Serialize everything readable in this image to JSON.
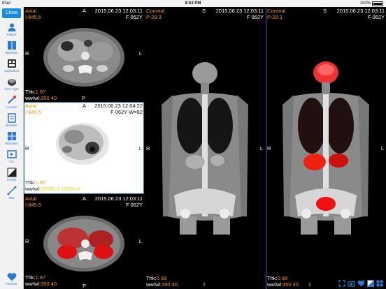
{
  "status": {
    "device": "iPad",
    "time": "8:53 PM",
    "battery": "100%"
  },
  "sidebar": {
    "close_label": "Close",
    "items": [
      {
        "label": "Patient",
        "icon": "person-icon"
      },
      {
        "label": "Windows",
        "icon": "windows-icon"
      },
      {
        "label": "Application",
        "icon": "application-icon"
      },
      {
        "label": "View Type",
        "icon": "view-type-icon"
      },
      {
        "label": "Locator",
        "icon": "locator-icon"
      },
      {
        "label": "Browser",
        "icon": "browser-icon"
      },
      {
        "label": "Windows",
        "icon": "windows-icon"
      },
      {
        "label": "Cin",
        "icon": "cine-icon"
      },
      {
        "label": "Preset",
        "icon": "preset-icon"
      },
      {
        "label": "ROI",
        "icon": "roi-icon"
      },
      {
        "label": "Favorite",
        "icon": "heart-icon"
      }
    ]
  },
  "viewports": {
    "axial_ct": {
      "series": "Axial",
      "level": "I:845.5",
      "orient_top": "A",
      "datetime": "2015.06.23 12:03:11",
      "patient": "F 062Y",
      "left": "R",
      "right": "L",
      "bottom": "P"
    },
    "axial_pet": {
      "series": "Axial",
      "level": "I:845.5",
      "orient_top": "A",
      "datetime": "2015.06.23 12:04:22",
      "patient": "F 062Y W=82",
      "left": "R",
      "right": "L",
      "thk_label": "Thk:",
      "thk_value": "1.87",
      "wwwl_label": "ww/wl:",
      "wwwl_value": "20000.0 10000.0"
    },
    "axial_fusion": {
      "series": "Axial",
      "level": "I:845.5",
      "orient_top": "A",
      "datetime": "2015.06.23 12:03:11",
      "patient": "F 062Y",
      "left": "R",
      "right": "L",
      "bottom": "P",
      "thk_label": "Thk:",
      "thk_value": "1.87",
      "wwwl_label": "ww/wl:",
      "wwwl_value": "350 40"
    },
    "coronal_ct": {
      "series": "Coronal",
      "level": "P:29.3",
      "orient_top": "S",
      "datetime": "2015.06.23 12:03:11",
      "patient": "F 062Y",
      "left": "R",
      "right": "L",
      "bottom": "I",
      "thk_label": "Thk:",
      "thk_value": "0.98",
      "wwwl_label": "ww/wl:",
      "wwwl_value": "350 40"
    },
    "coronal_fusion": {
      "series": "Coronal",
      "level": "P:29.3",
      "orient_top": "S",
      "datetime": "2015.06.23 12:03:11",
      "patient": "F 062Y",
      "left": "R",
      "right": "L",
      "bottom": "I",
      "thk_label": "Thk:",
      "thk_value": "0.98",
      "wwwl_label": "ww/wl:",
      "wwwl_value": "350 40"
    },
    "axial_ct_footer": {
      "thk_label": "Thk:",
      "thk_value": "1.87",
      "wwwl_label": "ww/wl:",
      "wwwl_value": "350 40"
    }
  },
  "colors": {
    "accent": "#1a8ae0",
    "annotation_orange": "#f2941d",
    "selection_border": "#2b62c7"
  }
}
